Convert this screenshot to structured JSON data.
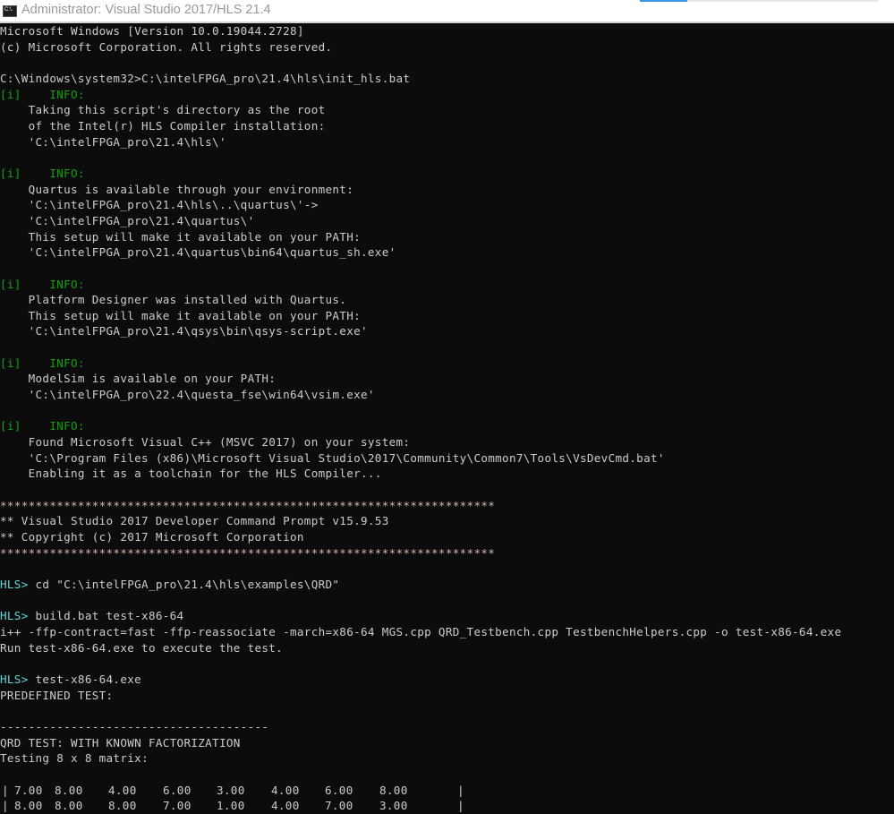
{
  "window": {
    "title": "Administrator:  Visual Studio 2017/HLS 21.4",
    "icon": "cmd-icon",
    "icon_text": "C:\\."
  },
  "colors": {
    "background": "#0c0c0c",
    "text": "#cccccc",
    "info": "#13a10e",
    "prompt": "#61d6d6"
  },
  "lines": [
    [
      {
        "t": "Microsoft Windows [Version 10.0.19044.2728]"
      }
    ],
    [
      {
        "t": "(c) Microsoft Corporation. All rights reserved."
      }
    ],
    [],
    [
      {
        "t": "C:\\Windows\\system32>C:\\intelFPGA_pro\\21.4\\hls\\init_hls.bat"
      }
    ],
    [
      {
        "t": "[i]    INFO:",
        "c": "green"
      }
    ],
    [
      {
        "t": "    Taking this script's directory as the root"
      }
    ],
    [
      {
        "t": "    of the Intel(r) HLS Compiler installation:"
      }
    ],
    [
      {
        "t": "    'C:\\intelFPGA_pro\\21.4\\hls\\'"
      }
    ],
    [],
    [
      {
        "t": "[i]    INFO:",
        "c": "green"
      }
    ],
    [
      {
        "t": "    Quartus is available through your environment:"
      }
    ],
    [
      {
        "t": "    'C:\\intelFPGA_pro\\21.4\\hls\\..\\quartus\\'->"
      }
    ],
    [
      {
        "t": "    'C:\\intelFPGA_pro\\21.4\\quartus\\'"
      }
    ],
    [
      {
        "t": "    This setup will make it available on your PATH:"
      }
    ],
    [
      {
        "t": "    'C:\\intelFPGA_pro\\21.4\\quartus\\bin64\\quartus_sh.exe'"
      }
    ],
    [],
    [
      {
        "t": "[i]    INFO:",
        "c": "green"
      }
    ],
    [
      {
        "t": "    Platform Designer was installed with Quartus."
      }
    ],
    [
      {
        "t": "    This setup will make it available on your PATH:"
      }
    ],
    [
      {
        "t": "    'C:\\intelFPGA_pro\\21.4\\qsys\\bin\\qsys-script.exe'"
      }
    ],
    [],
    [
      {
        "t": "[i]    INFO:",
        "c": "green"
      }
    ],
    [
      {
        "t": "    ModelSim is available on your PATH:"
      }
    ],
    [
      {
        "t": "    'C:\\intelFPGA_pro\\22.4\\questa_fse\\win64\\vsim.exe'"
      }
    ],
    [],
    [
      {
        "t": "[i]    INFO:",
        "c": "green"
      }
    ],
    [
      {
        "t": "    Found Microsoft Visual C++ (MSVC 2017) on your system:"
      }
    ],
    [
      {
        "t": "    'C:\\Program Files (x86)\\Microsoft Visual Studio\\2017\\Community\\Common7\\Tools\\VsDevCmd.bat'"
      }
    ],
    [
      {
        "t": "    Enabling it as a toolchain for the HLS Compiler..."
      }
    ],
    [],
    [
      {
        "t": "**********************************************************************",
        "c": "stars"
      }
    ],
    [
      {
        "t": "** Visual Studio 2017 Developer Command Prompt v15.9.53"
      }
    ],
    [
      {
        "t": "** Copyright (c) 2017 Microsoft Corporation"
      }
    ],
    [
      {
        "t": "**********************************************************************",
        "c": "stars"
      }
    ],
    [],
    [
      {
        "t": "HLS>",
        "c": "cyan"
      },
      {
        "t": " cd \"C:\\intelFPGA_pro\\21.4\\hls\\examples\\QRD\""
      }
    ],
    [],
    [
      {
        "t": "HLS>",
        "c": "cyan"
      },
      {
        "t": " build.bat test-x86-64"
      }
    ],
    [
      {
        "t": "i++ -ffp-contract=fast -ffp-reassociate -march=x86-64 MGS.cpp QRD_Testbench.cpp TestbenchHelpers.cpp -o test-x86-64.exe"
      }
    ],
    [
      {
        "t": "Run test-x86-64.exe to execute the test."
      }
    ],
    [],
    [
      {
        "t": "HLS>",
        "c": "cyan"
      },
      {
        "t": " test-x86-64.exe"
      }
    ],
    [
      {
        "t": "PREDEFINED TEST:"
      }
    ],
    [],
    [
      {
        "t": "--------------------------------------"
      }
    ],
    [
      {
        "t": "QRD TEST: WITH KNOWN FACTORIZATION"
      }
    ],
    [
      {
        "t": "Testing 8 x 8 matrix:"
      }
    ],
    []
  ],
  "matrix": {
    "border": "|",
    "rows": [
      [
        "7.00",
        "8.00",
        "4.00",
        "6.00",
        "3.00",
        "4.00",
        "6.00",
        "8.00"
      ],
      [
        "8.00",
        "8.00",
        "8.00",
        "7.00",
        "1.00",
        "4.00",
        "7.00",
        "3.00"
      ]
    ]
  }
}
